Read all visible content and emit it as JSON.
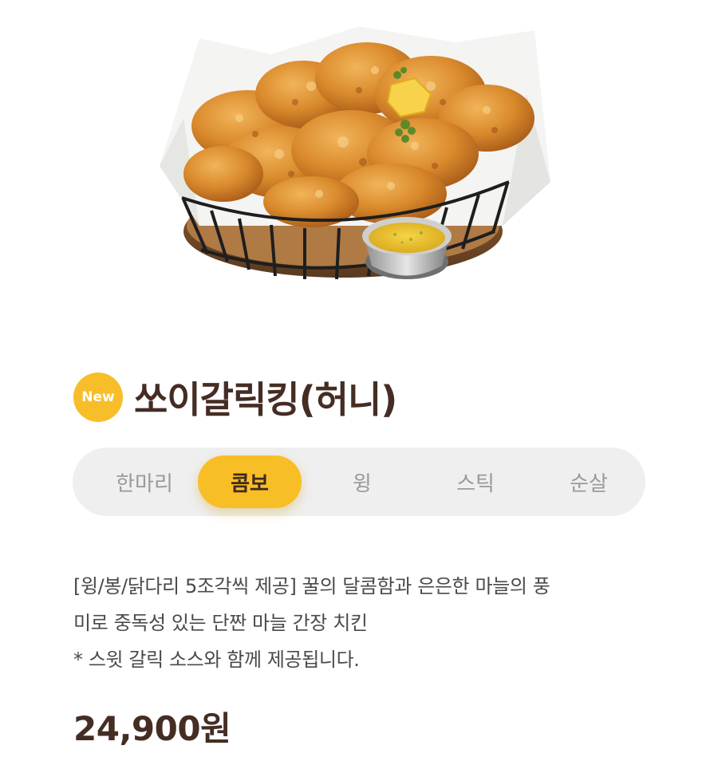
{
  "product": {
    "image_alt": "product-image",
    "badge": "New",
    "name": "쏘이갈릭킹(허니)",
    "options": [
      {
        "label": "한마리",
        "selected": false
      },
      {
        "label": "콤보",
        "selected": true
      },
      {
        "label": "윙",
        "selected": false
      },
      {
        "label": "스틱",
        "selected": false
      },
      {
        "label": "순살",
        "selected": false
      }
    ],
    "description_lines": [
      "[윙/봉/닭다리 5조각씩 제공] 꿀의 달콤함과 은은한 마늘의 풍",
      "미로 중독성 있는 단짠 마늘 간장 치킨",
      "* 스윗 갈릭 소스와 함께 제공됩니다."
    ],
    "price": "24,900원"
  },
  "colors": {
    "accent": "#f8be25",
    "title": "#452d24",
    "tab_bg": "#efefef",
    "tab_inactive_text": "#9a9a9a"
  }
}
